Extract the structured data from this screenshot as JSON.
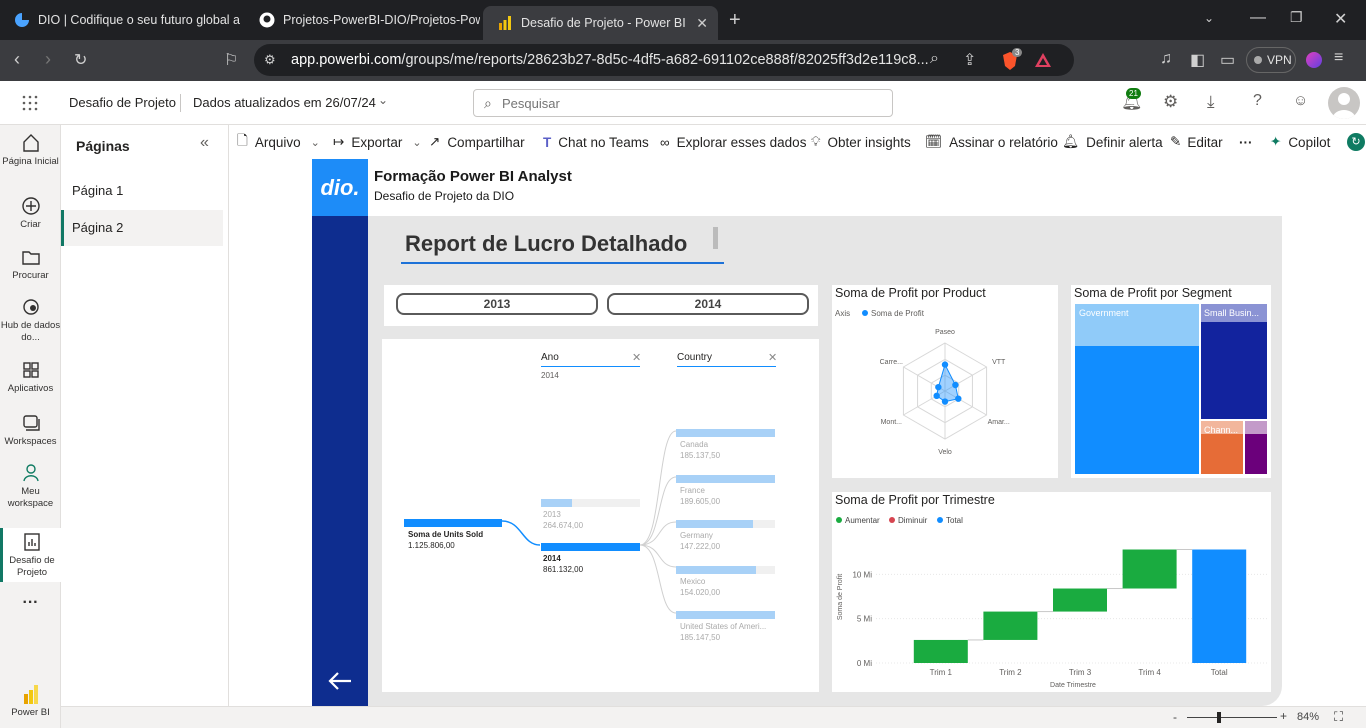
{
  "browser": {
    "tabs": [
      {
        "title": "DIO | Codifique o seu futuro global a",
        "icon": "dio-favicon"
      },
      {
        "title": "Projetos-PowerBI-DIO/Projetos-Pow",
        "icon": "github-icon"
      },
      {
        "title": "Desafio de Projeto - Power BI",
        "icon": "powerbi-icon"
      }
    ],
    "url_host": "app.powerbi.com",
    "url_path": "/groups/me/reports/28623b27-8d5c-4df5-a682-691102ce888f/82025ff3d2e119c8...",
    "vpn_label": "VPN",
    "brave_badge": "3"
  },
  "pbi": {
    "report_name": "Desafio de Projeto",
    "updated": "Dados atualizados em 26/07/24",
    "search_placeholder": "Pesquisar",
    "notif_count": "21"
  },
  "leftnav": [
    {
      "label": "Página Inicial",
      "icon": "home-icon"
    },
    {
      "label": "Criar",
      "icon": "plus-circle-icon"
    },
    {
      "label": "Procurar",
      "icon": "folder-icon"
    },
    {
      "label": "Hub de dados do...",
      "icon": "datahub-icon"
    },
    {
      "label": "Aplicativos",
      "icon": "apps-icon"
    },
    {
      "label": "Workspaces",
      "icon": "workspaces-icon"
    },
    {
      "label": "Meu workspace",
      "icon": "person-icon"
    },
    {
      "label": "Desafio de Projeto",
      "icon": "report-icon"
    },
    {
      "label": "Power BI",
      "icon": "powerbi-logo-icon"
    }
  ],
  "pages_panel": {
    "title": "Páginas",
    "items": [
      "Página 1",
      "Página 2"
    ],
    "active_index": 1
  },
  "toolbar": {
    "arquivo": "Arquivo",
    "exportar": "Exportar",
    "compartilhar": "Compartilhar",
    "chat": "Chat no Teams",
    "explorar": "Explorar esses dados",
    "insights": "Obter insights",
    "assinar": "Assinar o relatório",
    "alerta": "Definir alerta",
    "editar": "Editar",
    "copilot": "Copilot"
  },
  "report": {
    "brand": "dio.",
    "header_title": "Formação Power BI Analyst",
    "header_subtitle": "Desafio de Projeto da DIO",
    "page_title": "Report de Lucro Detalhado",
    "year_buttons": [
      "2013",
      "2014"
    ]
  },
  "decomp_tree": {
    "level1_header": "Ano",
    "level1_selected": "2014",
    "level2_header": "Country",
    "root_label": "Soma de Units Sold",
    "root_value": "1.125.806,00",
    "years": [
      {
        "label": "2013",
        "value": "264.674,00",
        "fraction": 0.31
      },
      {
        "label": "2014",
        "value": "861.132,00",
        "fraction": 1.0
      }
    ],
    "countries": [
      {
        "label": "Canada",
        "value": "185.137,50",
        "fraction": 1.0
      },
      {
        "label": "France",
        "value": "189.605,00",
        "fraction": 1.0
      },
      {
        "label": "Germany",
        "value": "147.222,00",
        "fraction": 0.78
      },
      {
        "label": "Mexico",
        "value": "154.020,00",
        "fraction": 0.81
      },
      {
        "label": "United States of Ameri...",
        "value": "185.147,50",
        "fraction": 1.0
      }
    ]
  },
  "radar": {
    "title": "Soma de Profit por Product",
    "legend_axis": "Axis",
    "legend_series": "Soma de Profit",
    "axes": [
      "Paseo",
      "VTT",
      "Amar...",
      "Velo",
      "Mont...",
      "Carre..."
    ],
    "values": [
      0.55,
      0.25,
      0.32,
      0.22,
      0.2,
      0.16
    ]
  },
  "treemap": {
    "title": "Soma de Profit por Segment",
    "segments": [
      "Government",
      "Small Busin...",
      "Chann..."
    ]
  },
  "waterfall": {
    "title": "Soma de Profit por Trimestre",
    "legend": [
      "Aumentar",
      "Diminuir",
      "Total"
    ],
    "xlabel": "Date Trimestre",
    "ylabel": "Soma de Profit"
  },
  "chart_data": [
    {
      "type": "bar",
      "title": "Soma de Profit por Trimestre",
      "xlabel": "Date Trimestre",
      "ylabel": "Soma de Profit",
      "categories": [
        "Trim 1",
        "Trim 2",
        "Trim 3",
        "Trim 4",
        "Total"
      ],
      "values": [
        2.6,
        3.2,
        2.6,
        4.4,
        12.8
      ],
      "yticks": [
        "0 Mi",
        "5 Mi",
        "10 Mi"
      ],
      "ylim": [
        0,
        15
      ],
      "colors": {
        "increase": "#1aab40",
        "decrease": "#d64550",
        "total": "#118dff"
      }
    }
  ],
  "footer": {
    "zoom": "84%"
  }
}
